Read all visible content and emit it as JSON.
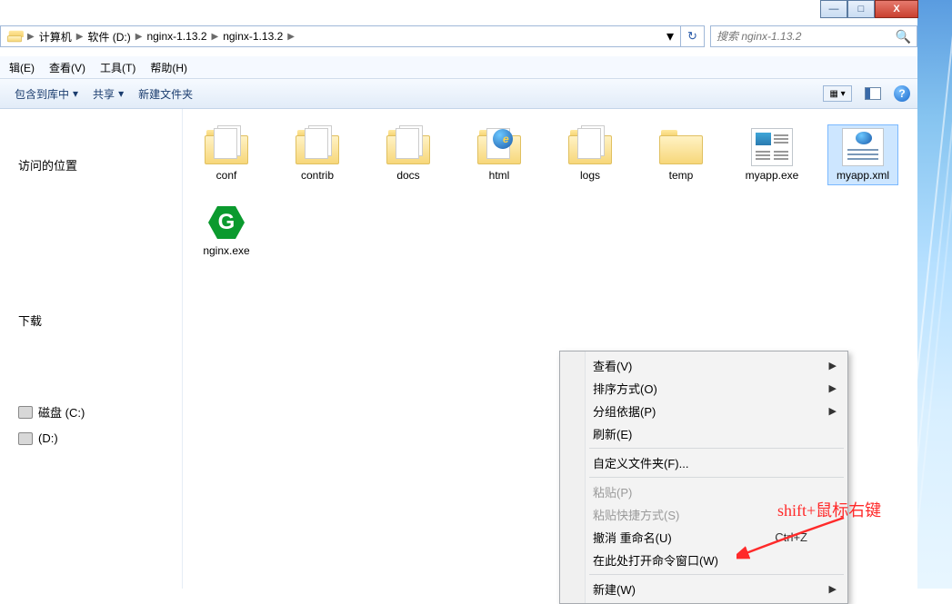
{
  "windowControls": {
    "min": "—",
    "max": "□",
    "close": "X"
  },
  "breadcrumb": [
    "计算机",
    "软件 (D:)",
    "nginx-1.13.2",
    "nginx-1.13.2"
  ],
  "search": {
    "placeholder": "搜索 nginx-1.13.2"
  },
  "menubar": [
    "辑(E)",
    "查看(V)",
    "工具(T)",
    "帮助(H)"
  ],
  "toolbar": {
    "includeLib": "包含到库中",
    "share": "共享",
    "newFolder": "新建文件夹"
  },
  "nav": {
    "item0": "",
    "recent": "访问的位置",
    "downloads": "下载",
    "diskC": "磁盘 (C:)",
    "diskD": "(D:)"
  },
  "files": [
    {
      "name": "conf",
      "type": "folder-open"
    },
    {
      "name": "contrib",
      "type": "folder-open"
    },
    {
      "name": "docs",
      "type": "folder-open"
    },
    {
      "name": "html",
      "type": "folder-html"
    },
    {
      "name": "logs",
      "type": "folder-open"
    },
    {
      "name": "temp",
      "type": "folder"
    },
    {
      "name": "myapp.exe",
      "type": "exe"
    },
    {
      "name": "myapp.xml",
      "type": "xml",
      "selected": true
    },
    {
      "name": "nginx.exe",
      "type": "nginx"
    }
  ],
  "contextMenu": [
    {
      "label": "查看(V)",
      "submenu": true
    },
    {
      "label": "排序方式(O)",
      "submenu": true
    },
    {
      "label": "分组依据(P)",
      "submenu": true
    },
    {
      "label": "刷新(E)"
    },
    {
      "sep": true
    },
    {
      "label": "自定义文件夹(F)..."
    },
    {
      "sep": true
    },
    {
      "label": "粘贴(P)",
      "disabled": true
    },
    {
      "label": "粘贴快捷方式(S)",
      "disabled": true
    },
    {
      "label": "撤消 重命名(U)",
      "shortcut": "Ctrl+Z"
    },
    {
      "label": "在此处打开命令窗口(W)"
    },
    {
      "sep": true
    },
    {
      "label": "新建(W)",
      "submenu": true
    }
  ],
  "annotation": "shift+鼠标右键"
}
